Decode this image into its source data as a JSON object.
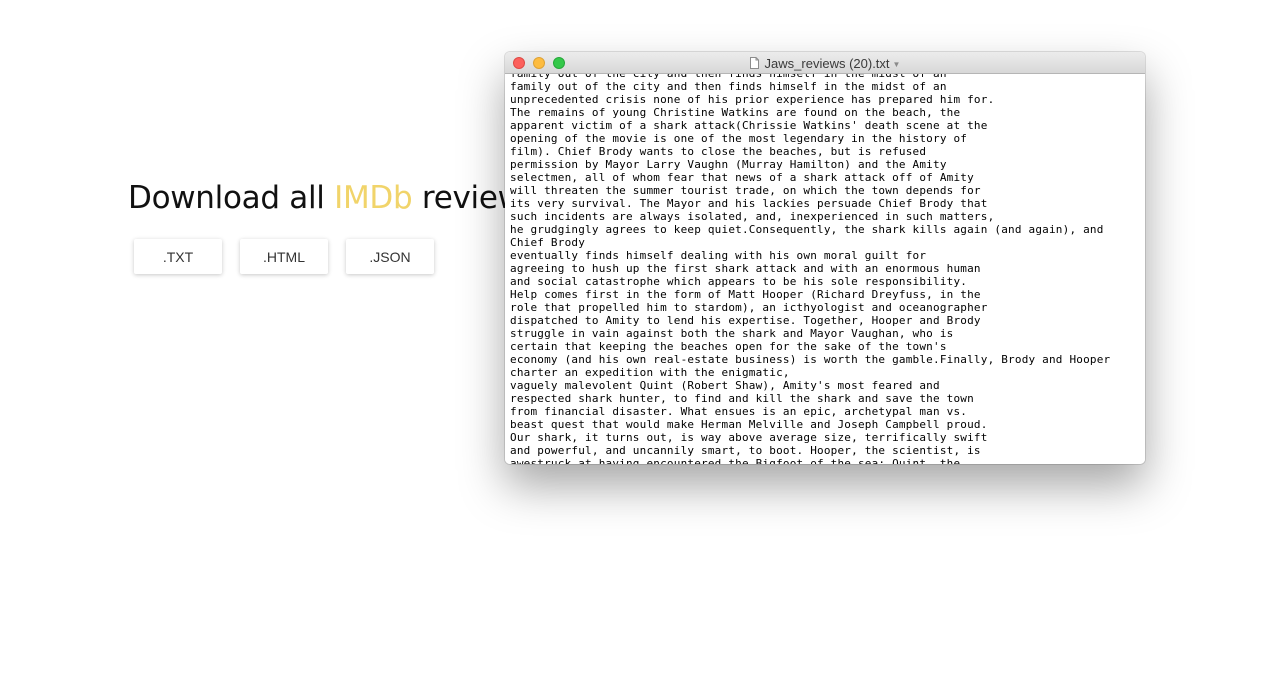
{
  "page": {
    "headline_prefix": "Download all ",
    "headline_accent": "IMDb",
    "headline_suffix": " reviews"
  },
  "buttons": {
    "txt": ".TXT",
    "html": ".HTML",
    "json": ".JSON"
  },
  "colors": {
    "accent": "#f1d46a"
  },
  "window": {
    "title": "Jaws_reviews (20).txt",
    "icon": "document-icon",
    "lines": [
      "family out of the city and then finds himself in the midst of an",
      "family out of the city and then finds himself in the midst of an",
      "unprecedented crisis none of his prior experience has prepared him for.",
      "The remains of young Christine Watkins are found on the beach, the",
      "apparent victim of a shark attack(Chrissie Watkins' death scene at the",
      "opening of the movie is one of the most legendary in the history of",
      "film). Chief Brody wants to close the beaches, but is refused",
      "permission by Mayor Larry Vaughn (Murray Hamilton) and the Amity",
      "selectmen, all of whom fear that news of a shark attack off of Amity",
      "will threaten the summer tourist trade, on which the town depends for",
      "its very survival. The Mayor and his lackies persuade Chief Brody that",
      "such incidents are always isolated, and, inexperienced in such matters,",
      "he grudgingly agrees to keep quiet.Consequently, the shark kills again (and again), and",
      "Chief Brody",
      "eventually finds himself dealing with his own moral guilt for",
      "agreeing to hush up the first shark attack and with an enormous human",
      "and social catastrophe which appears to be his sole responsibility.",
      "Help comes first in the form of Matt Hooper (Richard Dreyfuss, in the",
      "role that propelled him to stardom), an icthyologist and oceanographer",
      "dispatched to Amity to lend his expertise. Together, Hooper and Brody",
      "struggle in vain against both the shark and Mayor Vaughan, who is",
      "certain that keeping the beaches open for the sake of the town's",
      "economy (and his own real-estate business) is worth the gamble.Finally, Brody and Hooper",
      "charter an expedition with the enigmatic,",
      "vaguely malevolent Quint (Robert Shaw), Amity's most feared and",
      "respected shark hunter, to find and kill the shark and save the town",
      "from financial disaster. What ensues is an epic, archetypal man vs.",
      "beast quest that would make Herman Melville and Joseph Campbell proud.",
      "Our shark, it turns out, is way above average size, terrifically swift",
      "and powerful, and uncannily smart, to boot. Hooper, the scientist, is",
      "awestruck at having encountered the Bigfoot of the sea; Quint, the"
    ]
  }
}
